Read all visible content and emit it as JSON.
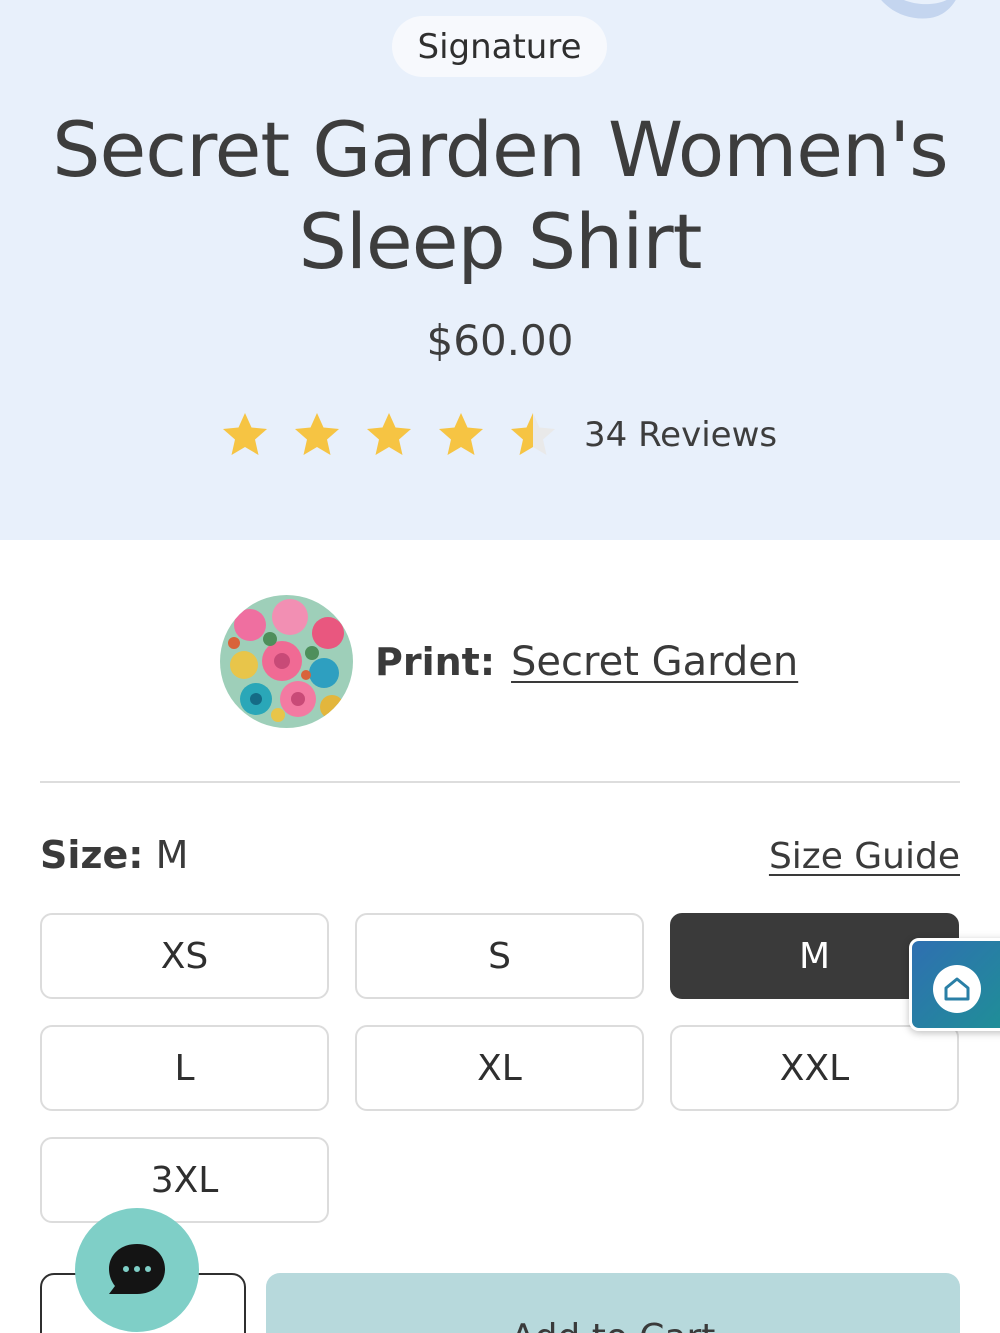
{
  "header": {
    "badge": "Signature",
    "title_line1": "Secret Garden Women's",
    "title_line2": "Sleep Shirt",
    "price": "$60.00",
    "rating": 4.5,
    "rating_max": 5,
    "reviews": "34 Reviews"
  },
  "print": {
    "label": "Print:",
    "value": "Secret Garden"
  },
  "size": {
    "label": "Size:",
    "selected": "M",
    "guide_label": "Size Guide",
    "options": [
      "XS",
      "S",
      "M",
      "L",
      "XL",
      "XXL",
      "3XL"
    ]
  },
  "cart": {
    "add_label": "Add to Cart"
  },
  "colors": {
    "hero_bg": "#e8f0fb",
    "star": "#f6c443",
    "selected_bg": "#3a3a3a",
    "add_button": "#b7d9dc",
    "chat_button": "#7fcfc7"
  },
  "icons": {
    "widget": "home-icon",
    "chat": "chat-bubble-icon",
    "rating": "star-icon"
  }
}
